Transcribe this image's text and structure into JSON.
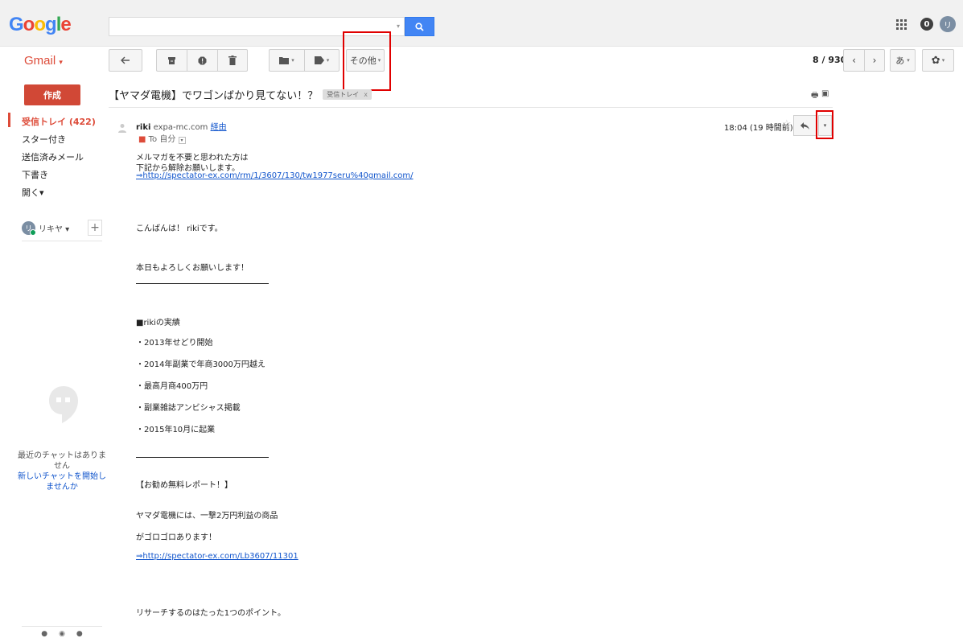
{
  "logo": {
    "letters": [
      "G",
      "o",
      "o",
      "g",
      "l",
      "e"
    ],
    "colors": [
      "#4285f4",
      "#ea4335",
      "#fbbc05",
      "#4285f4",
      "#34a853",
      "#ea4335"
    ]
  },
  "search": {
    "value": "",
    "placeholder": ""
  },
  "top_right": {
    "notif_count": "0",
    "avatar_initial": "リ"
  },
  "app": {
    "label": "Gmail",
    "caret": "▾"
  },
  "toolbar": {
    "more_label": "その他",
    "page_count": "8 / 930",
    "input_tool_label": "あ"
  },
  "sidebar": {
    "compose_label": "作成",
    "items": [
      {
        "label": "受信トレイ (422)"
      },
      {
        "label": "スター付き"
      },
      {
        "label": "送信済みメール"
      },
      {
        "label": "下書き"
      },
      {
        "label": "開く▾"
      }
    ],
    "chat_user": "リキヤ ▾",
    "chat_initial": "リ",
    "chat_empty_text": "最近のチャットはありません",
    "chat_new_link": "新しいチャットを開始しませんか"
  },
  "message": {
    "subject": "【ヤマダ電機】でワゴンばかり見てない！？",
    "label_chip": "受信トレイ",
    "label_chip_close": "x",
    "sender_name": "riki",
    "sender_domain": "expa-mc.com",
    "sender_via": "経由",
    "to_line": "To 自分",
    "timestamp": "18:04 (19 時間前)",
    "body": {
      "line1": "メルマガを不要と思われた方は",
      "line2": "下記から解除お願いします。",
      "link1": "⇒http://spectator-ex.com/rm/1/3607/130/tw1977seru%40gmail.com/",
      "greeting": "こんばんは！ rikiです。",
      "regards": "本日もよろしくお願いします！",
      "results_title": "■rikiの実績",
      "result1": "・2013年せどり開始",
      "result2": "・2014年副業で年商3000万円越え",
      "result3": "・最高月商400万円",
      "result4": "・副業雑誌アンビシャス掲載",
      "result5": "・2015年10月に起業",
      "report_title": "【お勧め無料レポート！】",
      "report1": "ヤマダ電機には、一撃2万円利益の商品",
      "report2": "がゴロゴロあります！",
      "link2": "⇒http://spectator-ex.com/Lb3607/11301",
      "closing": "リサーチするのはたった1つのポイント。"
    }
  }
}
